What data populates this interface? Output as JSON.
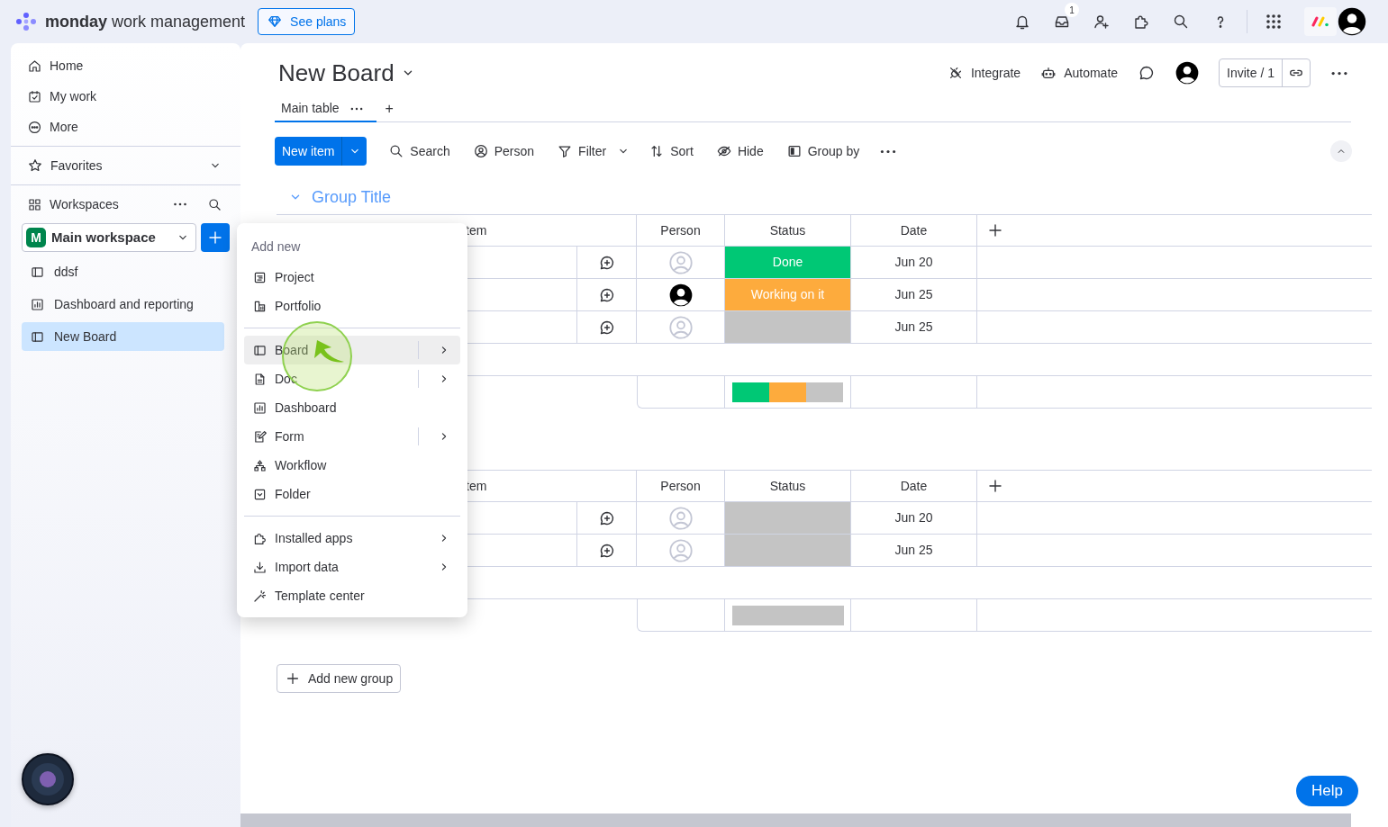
{
  "top_bar": {
    "brand_bold": "monday",
    "brand_light": "work management",
    "plans_button": "See plans",
    "inbox_badge": "1"
  },
  "sidebar": {
    "nav": [
      {
        "label": "Home"
      },
      {
        "label": "My work"
      },
      {
        "label": "More"
      }
    ],
    "favorites": "Favorites",
    "workspaces_label": "Workspaces",
    "workspace": {
      "initial": "M",
      "name": "Main workspace"
    },
    "items": [
      {
        "label": "ddsf",
        "kind": "board",
        "selected": false
      },
      {
        "label": "Dashboard and reporting",
        "kind": "dashboard",
        "selected": false
      },
      {
        "label": "New Board",
        "kind": "board",
        "selected": true
      }
    ]
  },
  "board": {
    "title": "New Board",
    "integrate": "Integrate",
    "automate": "Automate",
    "invite": "Invite / 1",
    "tabs": [
      {
        "label": "Main table",
        "selected": true
      }
    ],
    "add_tab": "+",
    "new_item": "New item",
    "tools": [
      {
        "label": "Search"
      },
      {
        "label": "Person"
      },
      {
        "label": "Filter"
      },
      {
        "label": "Sort"
      },
      {
        "label": "Hide"
      },
      {
        "label": "Group by"
      }
    ],
    "groups": [
      {
        "title": "Group Title",
        "columns": [
          "tem",
          "Person",
          "Status",
          "Date"
        ],
        "rows": [
          {
            "assigned": false,
            "status": "Done",
            "color": "#00c875",
            "date": "Jun 20"
          },
          {
            "assigned": true,
            "status": "Working on it",
            "color": "#fdab3d",
            "date": "Jun 25"
          },
          {
            "assigned": false,
            "color": "#c4c4c4",
            "date": "Jun 25"
          }
        ]
      },
      {
        "columns": [
          "tem",
          "Person",
          "Status",
          "Date"
        ],
        "rows": [
          {
            "assigned": false,
            "color": "#c4c4c4",
            "date": "Jun 20"
          },
          {
            "assigned": false,
            "color": "#c4c4c4",
            "date": "Jun 25"
          }
        ]
      }
    ],
    "add_group": "Add new group"
  },
  "menu": {
    "heading": "Add new",
    "sections": [
      {
        "items": [
          {
            "label": "Project",
            "kind": "action",
            "highlighted": false
          },
          {
            "label": "Portfolio",
            "kind": "action",
            "highlighted": false
          }
        ]
      },
      {
        "items": [
          {
            "label": "Board",
            "kind": "split",
            "highlighted": true
          },
          {
            "label": "Doc",
            "kind": "split",
            "highlighted": false
          },
          {
            "label": "Dashboard",
            "kind": "action",
            "highlighted": false
          },
          {
            "label": "Form",
            "kind": "split",
            "highlighted": false
          },
          {
            "label": "Workflow",
            "kind": "action",
            "highlighted": false
          },
          {
            "label": "Folder",
            "kind": "action",
            "highlighted": false
          }
        ]
      },
      {
        "items": [
          {
            "label": "Installed apps",
            "kind": "submenu",
            "highlighted": false
          },
          {
            "label": "Import data",
            "kind": "submenu",
            "highlighted": false
          },
          {
            "label": "Template center",
            "kind": "action",
            "highlighted": false
          }
        ]
      }
    ]
  },
  "help_button": "Help"
}
